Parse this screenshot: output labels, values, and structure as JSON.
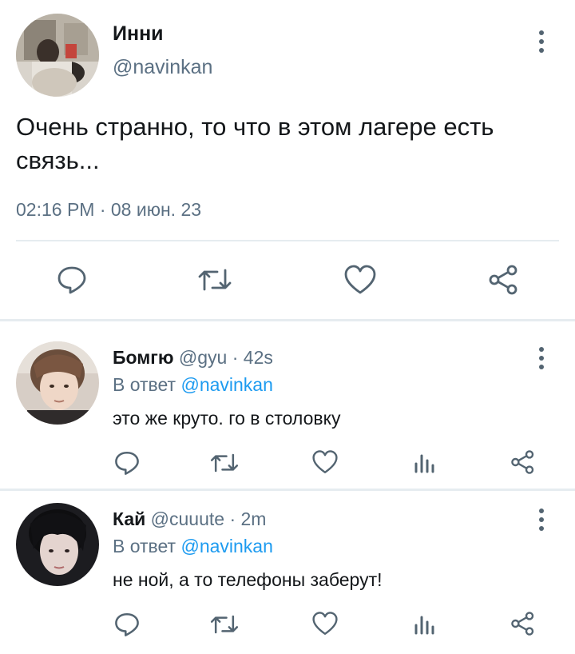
{
  "main_tweet": {
    "author_name": "Инни",
    "author_handle": "@navinkan",
    "text": "Очень странно, то что в этом лагере есть связь...",
    "timestamp": "02:16 PM · 08 июн. 23",
    "actions": [
      "reply-icon",
      "retweet-icon",
      "like-icon",
      "share-icon"
    ]
  },
  "replies": [
    {
      "author_name": "Бомгю",
      "author_handle": "@gyu",
      "separator": "·",
      "time": "42s",
      "reply_prefix": "В ответ",
      "reply_mention": "@navinkan",
      "text": "это же круто. го в столовку",
      "actions": [
        "reply-icon",
        "retweet-icon",
        "like-icon",
        "analytics-icon",
        "share-icon"
      ]
    },
    {
      "author_name": "Кай",
      "author_handle": "@cuuute",
      "separator": "·",
      "time": "2m",
      "reply_prefix": "В ответ",
      "reply_mention": "@navinkan",
      "text": "не ной, а то телефоны заберут!",
      "actions": [
        "reply-icon",
        "retweet-icon",
        "like-icon",
        "analytics-icon",
        "share-icon"
      ]
    }
  ],
  "colors": {
    "icon_gray": "#536471",
    "secondary_text": "#5b7083",
    "link_blue": "#1d9bf0",
    "divider": "#e6ecf0"
  }
}
